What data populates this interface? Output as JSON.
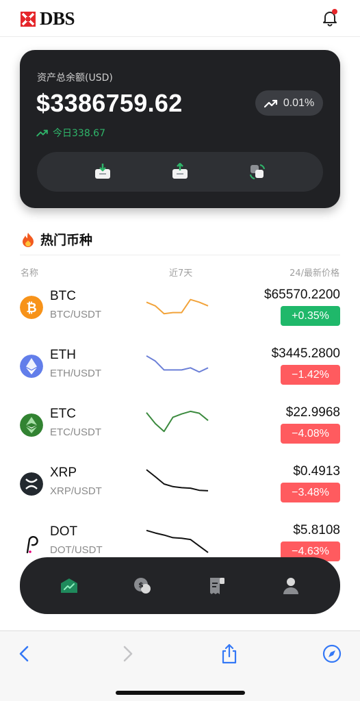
{
  "header": {
    "brand": "DBS",
    "logo_icon": "dbs-logo-icon",
    "bell_icon": "bell-icon",
    "has_notification": true
  },
  "balance": {
    "label": "资产总余额(USD)",
    "amount": "$3386759.62",
    "change_pct": "0.01%",
    "today": "今日338.67",
    "actions": [
      "deposit-icon",
      "withdraw-icon",
      "transfer-icon"
    ]
  },
  "hot": {
    "title": "热门币种",
    "title_icon": "fire-icon",
    "columns": {
      "name": "名称",
      "trend": "近7天",
      "price": "24/最新价格"
    },
    "rows": [
      {
        "symbol": "BTC",
        "pair": "BTC/USDT",
        "price": "$65570.2200",
        "change": "+0.35%",
        "direction": "up",
        "icon": "bitcoin-icon",
        "spark_color": "#f2a33a",
        "spark": [
          0.62,
          0.48,
          0.18,
          0.22,
          0.22,
          0.72,
          0.62,
          0.48
        ]
      },
      {
        "symbol": "ETH",
        "pair": "ETH/USDT",
        "price": "$3445.2800",
        "change": "−1.42%",
        "direction": "down",
        "icon": "ethereum-icon",
        "spark_color": "#6b7fd7",
        "spark": [
          0.82,
          0.62,
          0.28,
          0.28,
          0.28,
          0.36,
          0.2,
          0.36
        ]
      },
      {
        "symbol": "ETC",
        "pair": "ETC/USDT",
        "price": "$22.9968",
        "change": "−4.08%",
        "direction": "down",
        "icon": "ethereum-classic-icon",
        "spark_color": "#3b8a3e",
        "spark": [
          0.9,
          0.48,
          0.18,
          0.72,
          0.85,
          0.95,
          0.88,
          0.6
        ]
      },
      {
        "symbol": "XRP",
        "pair": "XRP/USDT",
        "price": "$0.4913",
        "change": "−3.48%",
        "direction": "down",
        "icon": "xrp-icon",
        "spark_color": "#111111",
        "spark": [
          0.97,
          0.7,
          0.42,
          0.32,
          0.28,
          0.26,
          0.18,
          0.16
        ]
      },
      {
        "symbol": "DOT",
        "pair": "DOT/USDT",
        "price": "$5.8108",
        "change": "−4.63%",
        "direction": "down",
        "icon": "polkadot-icon",
        "spark_color": "#111111",
        "spark": [
          0.9,
          0.8,
          0.72,
          0.62,
          0.6,
          0.55,
          0.3,
          0.05
        ]
      }
    ]
  },
  "tabbar": {
    "tabs": [
      "home-chart-icon",
      "coins-icon",
      "receipt-icon",
      "profile-icon"
    ],
    "active": 0
  },
  "browser": {
    "buttons": [
      "back-icon",
      "forward-icon",
      "share-icon",
      "compass-icon"
    ]
  },
  "colors": {
    "up": "#1fb86a",
    "down": "#ff5b5f",
    "accent_green": "#2fb56a",
    "card_bg": "#202124",
    "ios_blue": "#3478f6"
  }
}
